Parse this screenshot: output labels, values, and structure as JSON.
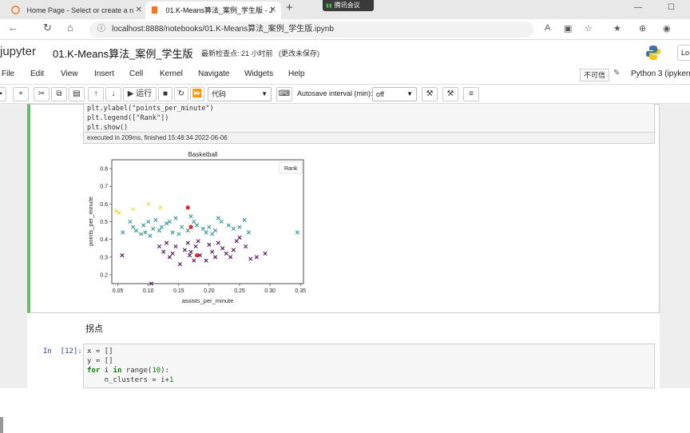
{
  "browser": {
    "tabs": [
      {
        "title": "Home Page - Select or create a n"
      },
      {
        "title": "01.K-Means算法_案例_学生版 - J"
      }
    ],
    "meeting_label": "腾讯会议",
    "url": "localhost:8888/notebooks/01.K-Means算法_案例_学生版.ipynb"
  },
  "jupyter": {
    "logo_text": "jupyter",
    "notebook_title": "01.K-Means算法_案例_学生版",
    "checkpoint": "最新检查点: 21 小时前",
    "unsaved": "(更改未保存)",
    "logout_label": "Lo"
  },
  "menubar": {
    "items": [
      "File",
      "Edit",
      "View",
      "Insert",
      "Cell",
      "Kernel",
      "Navigate",
      "Widgets",
      "Help"
    ],
    "trusted": "不可信",
    "kernel": "Python 3 (ipykerne"
  },
  "toolbar": {
    "run_label": "运行",
    "cell_type": "代码",
    "autosave_label": "Autosave interval (min):",
    "autosave_value": "off"
  },
  "cell1": {
    "code_lines": [
      "plt.ylabel(\"points_per_minute\")",
      "plt.legend([\"Rank\"])",
      "plt.show()"
    ],
    "exec_info": "executed in 209ms, finished 15:48:34 2022-06-06"
  },
  "chart_data": {
    "type": "scatter",
    "title": "Basketball",
    "xlabel": "assists_per_minute",
    "ylabel": "points_per_minute",
    "xlim": [
      0.04,
      0.355
    ],
    "ylim": [
      0.15,
      0.85
    ],
    "xticks": [
      "0.05",
      "0.10",
      "0.15",
      "0.20",
      "0.25",
      "0.30",
      "0.35"
    ],
    "yticks": [
      "0.2",
      "0.3",
      "0.4",
      "0.5",
      "0.6",
      "0.7",
      "0.8"
    ],
    "legend": [
      "Rank"
    ],
    "grid": false,
    "series": [
      {
        "color": "#f1d63a",
        "marker": "x",
        "points": [
          [
            0.047,
            0.56
          ],
          [
            0.052,
            0.55
          ],
          [
            0.075,
            0.57
          ],
          [
            0.1,
            0.6
          ],
          [
            0.12,
            0.58
          ]
        ]
      },
      {
        "color": "#21918c",
        "marker": "x",
        "points": [
          [
            0.058,
            0.44
          ],
          [
            0.07,
            0.5
          ],
          [
            0.075,
            0.47
          ],
          [
            0.08,
            0.45
          ],
          [
            0.088,
            0.43
          ],
          [
            0.092,
            0.48
          ],
          [
            0.095,
            0.44
          ],
          [
            0.1,
            0.5
          ],
          [
            0.103,
            0.42
          ],
          [
            0.108,
            0.46
          ],
          [
            0.112,
            0.51
          ],
          [
            0.118,
            0.45
          ],
          [
            0.122,
            0.47
          ],
          [
            0.13,
            0.49
          ],
          [
            0.135,
            0.5
          ],
          [
            0.14,
            0.44
          ],
          [
            0.145,
            0.52
          ],
          [
            0.15,
            0.43
          ],
          [
            0.155,
            0.47
          ],
          [
            0.165,
            0.45
          ],
          [
            0.17,
            0.53
          ],
          [
            0.175,
            0.5
          ],
          [
            0.18,
            0.48
          ],
          [
            0.19,
            0.46
          ],
          [
            0.195,
            0.44
          ],
          [
            0.2,
            0.47
          ],
          [
            0.205,
            0.43
          ],
          [
            0.21,
            0.45
          ],
          [
            0.215,
            0.52
          ],
          [
            0.22,
            0.5
          ],
          [
            0.232,
            0.48
          ],
          [
            0.24,
            0.46
          ],
          [
            0.25,
            0.47
          ],
          [
            0.258,
            0.51
          ],
          [
            0.265,
            0.44
          ],
          [
            0.345,
            0.44
          ]
        ]
      },
      {
        "color": "#440154",
        "marker": "x",
        "points": [
          [
            0.057,
            0.31
          ],
          [
            0.105,
            0.15
          ],
          [
            0.118,
            0.36
          ],
          [
            0.125,
            0.33
          ],
          [
            0.13,
            0.38
          ],
          [
            0.135,
            0.3
          ],
          [
            0.14,
            0.32
          ],
          [
            0.145,
            0.36
          ],
          [
            0.152,
            0.26
          ],
          [
            0.16,
            0.34
          ],
          [
            0.165,
            0.38
          ],
          [
            0.168,
            0.31
          ],
          [
            0.17,
            0.33
          ],
          [
            0.175,
            0.28
          ],
          [
            0.178,
            0.36
          ],
          [
            0.182,
            0.39
          ],
          [
            0.185,
            0.31
          ],
          [
            0.195,
            0.28
          ],
          [
            0.2,
            0.37
          ],
          [
            0.205,
            0.33
          ],
          [
            0.21,
            0.3
          ],
          [
            0.215,
            0.38
          ],
          [
            0.222,
            0.35
          ],
          [
            0.228,
            0.32
          ],
          [
            0.235,
            0.3
          ],
          [
            0.24,
            0.34
          ],
          [
            0.245,
            0.39
          ],
          [
            0.25,
            0.41
          ],
          [
            0.26,
            0.36
          ],
          [
            0.268,
            0.29
          ],
          [
            0.278,
            0.3
          ],
          [
            0.292,
            0.32
          ]
        ]
      }
    ],
    "centroids": {
      "color": "#e32828",
      "points": [
        [
          0.165,
          0.58
        ],
        [
          0.17,
          0.47
        ],
        [
          0.18,
          0.31
        ]
      ]
    }
  },
  "md_text": "拐点",
  "cell2": {
    "prompt": "In  [12]:",
    "lines": [
      [
        {
          "t": "x = []",
          "c": ""
        }
      ],
      [
        {
          "t": "y = []",
          "c": ""
        }
      ],
      [
        {
          "t": "for",
          "c": "kw"
        },
        {
          "t": " i ",
          "c": ""
        },
        {
          "t": "in",
          "c": "kw"
        },
        {
          "t": " range(",
          "c": ""
        },
        {
          "t": "10",
          "c": "num"
        },
        {
          "t": "):",
          "c": ""
        }
      ],
      [
        {
          "t": "    n_clusters = i+",
          "c": ""
        },
        {
          "t": "1",
          "c": "num"
        }
      ]
    ]
  },
  "colors": {
    "cell_selected": "#66bb6a",
    "accent": "#f37626"
  }
}
